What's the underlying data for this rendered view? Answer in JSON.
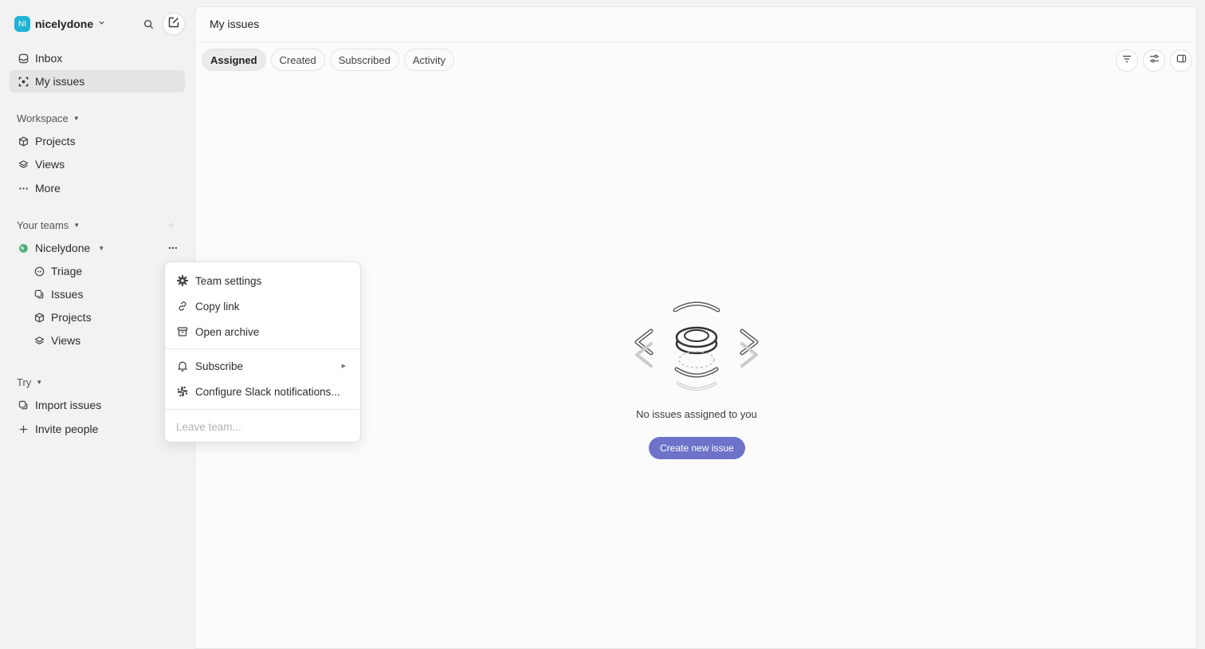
{
  "workspace": {
    "initials": "NI",
    "name": "nicelydone",
    "avatar_color": "#1fb3d4"
  },
  "sidebar": {
    "top_items": [
      {
        "label": "Inbox",
        "icon": "inbox-icon"
      },
      {
        "label": "My issues",
        "icon": "my-issues-icon",
        "active": true
      }
    ],
    "workspace_section": {
      "label": "Workspace",
      "items": [
        {
          "label": "Projects",
          "icon": "cube-icon"
        },
        {
          "label": "Views",
          "icon": "layers-icon"
        },
        {
          "label": "More",
          "icon": "ellipsis-icon"
        }
      ]
    },
    "teams_section": {
      "label": "Your teams",
      "team": {
        "name": "Nicelydone",
        "items": [
          {
            "label": "Triage",
            "icon": "triage-icon"
          },
          {
            "label": "Issues",
            "icon": "issues-icon"
          },
          {
            "label": "Projects",
            "icon": "cube-icon"
          },
          {
            "label": "Views",
            "icon": "layers-icon"
          }
        ]
      }
    },
    "try_section": {
      "label": "Try",
      "items": [
        {
          "label": "Import issues",
          "icon": "import-icon"
        },
        {
          "label": "Invite people",
          "icon": "plus-icon"
        }
      ]
    }
  },
  "main": {
    "title": "My issues",
    "tabs": [
      {
        "label": "Assigned",
        "active": true
      },
      {
        "label": "Created"
      },
      {
        "label": "Subscribed"
      },
      {
        "label": "Activity"
      }
    ],
    "empty_state": {
      "message": "No issues assigned to you",
      "button_label": "Create new issue",
      "button_color": "#6e72c9"
    }
  },
  "context_menu": {
    "items": [
      {
        "label": "Team settings",
        "icon": "gear-icon"
      },
      {
        "label": "Copy link",
        "icon": "link-icon"
      },
      {
        "label": "Open archive",
        "icon": "archive-icon"
      },
      {
        "label": "Subscribe",
        "icon": "bell-icon",
        "submenu": true
      },
      {
        "label": "Configure Slack notifications...",
        "icon": "slack-icon"
      },
      {
        "label": "Leave team...",
        "disabled": true
      }
    ]
  }
}
